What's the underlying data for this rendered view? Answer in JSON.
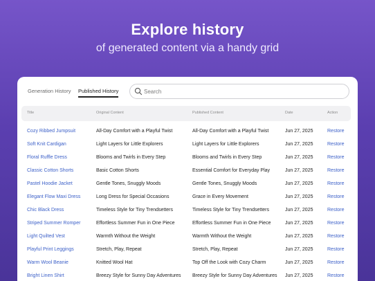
{
  "hero": {
    "title": "Explore history",
    "subtitle": "of generated content via a handy grid"
  },
  "tabs": [
    "Generation History",
    "Published History"
  ],
  "active_tab": "Published History",
  "search": {
    "placeholder": "Search",
    "value": ""
  },
  "table": {
    "columns": [
      "Title",
      "Original Content",
      "Published Content",
      "Date",
      "Action"
    ],
    "rows": [
      [
        "Cozy Ribbed Jumpsuit",
        "All-Day Comfort with a Playful Twist",
        "All-Day Comfort with a Playful Twist",
        "Jun 27, 2025",
        "Restore"
      ],
      [
        "Soft Knit Cardigan",
        "Light Layers for Little Explorers",
        "Light Layers for Little Explorers",
        "Jun 27, 2025",
        "Restore"
      ],
      [
        "Floral Ruffle Dress",
        "Blooms and Twirls in Every Step",
        "Blooms and Twirls in Every Step",
        "Jun 27, 2025",
        "Restore"
      ],
      [
        "Classic Cotton Shorts",
        "Basic Cotton Shorts",
        "Essential Comfort for Everyday Play",
        "Jun 27, 2025",
        "Restore"
      ],
      [
        "Pastel Hoodie Jacket",
        "Gentle Tones, Snuggly Moods",
        "Gentle Tones, Snuggly Moods",
        "Jun 27, 2025",
        "Restore"
      ],
      [
        "Elegant Flow Maxi Dress",
        "Long Dress for Special Occasions",
        "Grace in Every Movement",
        "Jun 27, 2025",
        "Restore"
      ],
      [
        "Chic Black Dress",
        "Timeless Style for Tiny Trendsetters",
        "Timeless Style for Tiny Trendsetters",
        "Jun 27, 2025",
        "Restore"
      ],
      [
        "Striped Summer Romper",
        "Effortless Summer Fun in One Piece",
        "Effortless Summer Fun in One Piece",
        "Jun 27, 2025",
        "Restore"
      ],
      [
        "Light Quilted Vest",
        "Warmth Without the Weight",
        "Warmth Without the Weight",
        "Jun 27, 2025",
        "Restore"
      ],
      [
        "Playful Print Leggings",
        "Stretch, Play, Repeat",
        "Stretch, Play, Repeat",
        "Jun 27, 2025",
        "Restore"
      ],
      [
        "Warm Wool Beanie",
        "Knitted Wool Hat",
        "Top Off the Look with Cozy Charm",
        "Jun 27, 2025",
        "Restore"
      ],
      [
        "Bright Linen Shirt",
        "Breezy Style for Sunny Day Adventures",
        "Breezy Style for Sunny Day Adventures",
        "Jun 27, 2025",
        "Restore"
      ]
    ]
  },
  "colors": {
    "link": "#3c60c8",
    "background_top": "#7655c9",
    "background_bottom": "#4a3499"
  },
  "icons": {
    "search": "search-icon"
  }
}
